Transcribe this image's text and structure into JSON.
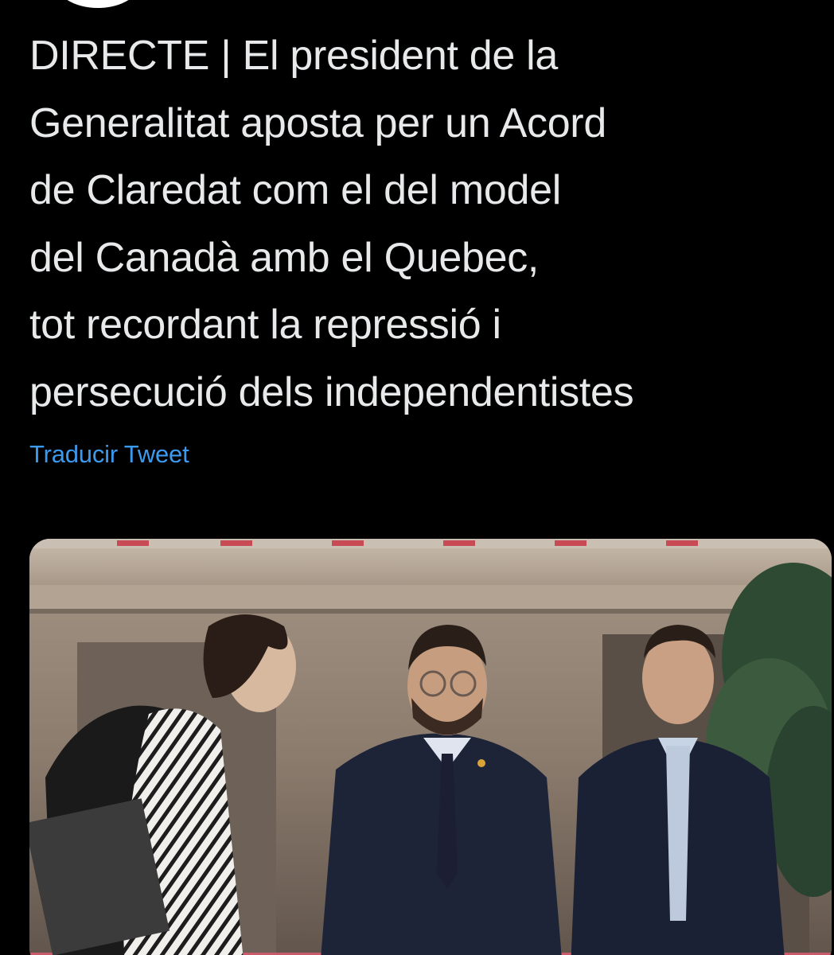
{
  "tweet": {
    "text_lines": [
      "DIRECTE | El president de la",
      "Generalitat aposta per un Acord",
      "de Claredat com el del model",
      "del Canadà amb el Quebec,",
      "tot recordant la repressió i",
      "persecució dels independentistes"
    ],
    "translate_label": "Traducir Tweet"
  },
  "colors": {
    "background": "#000000",
    "text": "#e7e9ea",
    "link": "#3c9aee"
  },
  "icons": {
    "avatar": "avatar-circle"
  }
}
